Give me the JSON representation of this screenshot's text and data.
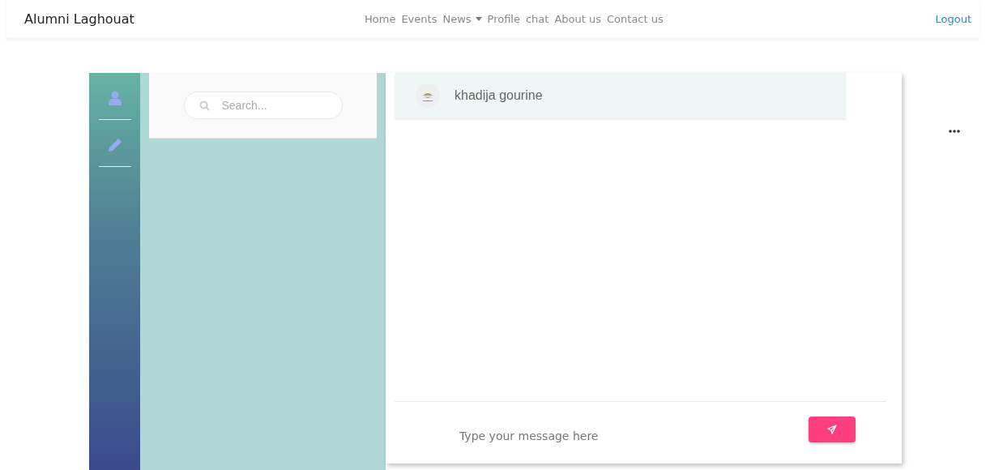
{
  "navbar": {
    "brand": "Alumni Laghouat",
    "links": [
      {
        "label": "Home",
        "kind": "link"
      },
      {
        "label": "Events",
        "kind": "link"
      },
      {
        "label": "News",
        "kind": "dropdown"
      },
      {
        "label": "Profile",
        "kind": "link"
      },
      {
        "label": "chat",
        "kind": "link"
      },
      {
        "label": "About us",
        "kind": "link"
      },
      {
        "label": "Contact us",
        "kind": "link"
      }
    ],
    "logout": "Logout"
  },
  "search": {
    "placeholder": "Search..."
  },
  "chat": {
    "contact_name": "khadija gourine",
    "message": {
      "placeholder": "Type your message here"
    }
  }
}
